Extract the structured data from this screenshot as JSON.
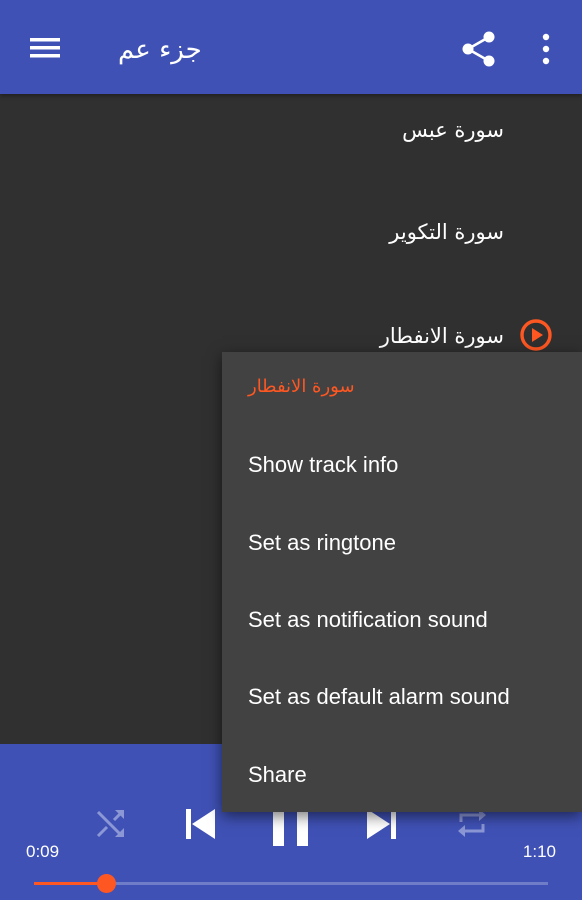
{
  "appbar": {
    "title": "جزء عم",
    "menu_icon": "hamburger-menu-icon",
    "share_icon": "share-icon",
    "more_icon": "more-vert-icon"
  },
  "tracks": [
    {
      "title": "سورة عبس",
      "playing": false
    },
    {
      "title": "سورة التكوير",
      "playing": false
    },
    {
      "title": "سورة الانفطار",
      "playing": true
    }
  ],
  "popup_menu": {
    "header": "سورة الانفطار",
    "items": [
      "Show track info",
      "Set as ringtone",
      "Set as notification sound",
      "Set as default alarm sound",
      "Share"
    ]
  },
  "player": {
    "elapsed": "0:09",
    "duration": "1:10",
    "progress": 0.14,
    "controls": [
      "shuffle-icon",
      "skip-previous-icon",
      "pause-icon",
      "skip-next-icon",
      "repeat-icon"
    ]
  },
  "colors": {
    "primary": "#3f51b5",
    "accent": "#ff5722",
    "background": "#303030",
    "popup": "#424242"
  }
}
